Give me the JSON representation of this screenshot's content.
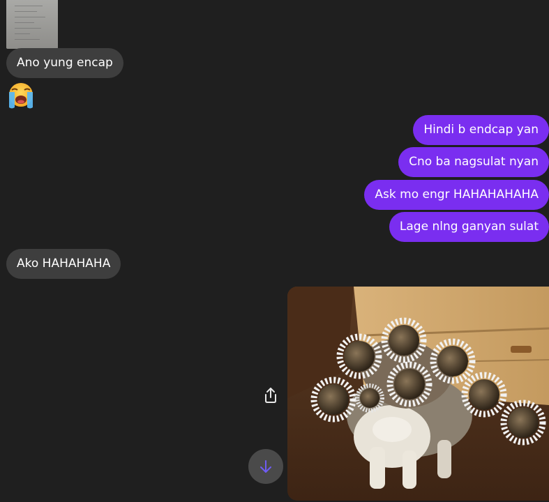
{
  "messages": [
    {
      "side": "in",
      "text": "Ano yung encap"
    },
    {
      "side": "out",
      "text": "Hindi b endcap yan"
    },
    {
      "side": "out",
      "text": "Cno ba nagsulat nyan"
    },
    {
      "side": "out",
      "text": "Ask mo engr HAHAHAHAHA"
    },
    {
      "side": "out",
      "text": "Lage nlng ganyan sulat"
    },
    {
      "side": "in",
      "text": "Ako HAHAHAHA"
    }
  ],
  "emoji": {
    "name": "loudly-crying-face-emoji",
    "glyph": "😭"
  },
  "image_attachments": [
    {
      "name": "notebook-photo-thumbnail"
    },
    {
      "name": "cat-loading-meme-image"
    }
  ],
  "colors": {
    "background": "#1f1f1f",
    "incoming_bubble": "#3e3e3e",
    "outgoing_bubble": "#7a2ef0",
    "accent_arrow": "#6f5cf4"
  },
  "icons": [
    "share-icon",
    "arrow-down-icon"
  ]
}
